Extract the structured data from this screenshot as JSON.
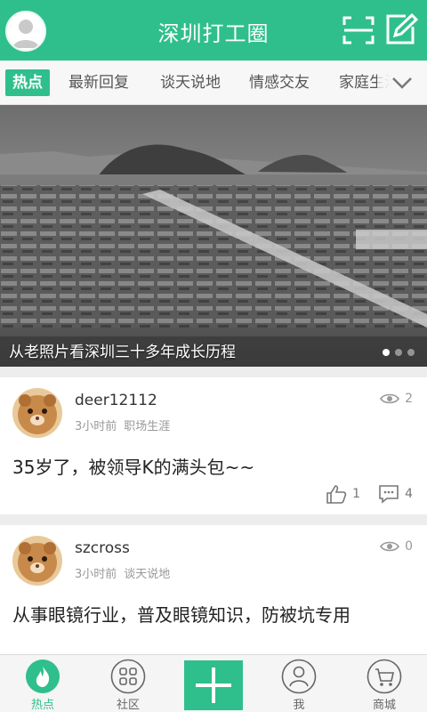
{
  "header": {
    "title": "深圳打工圈",
    "avatar_icon": "default-user-avatar",
    "scan_icon": "scan-icon",
    "edit_icon": "edit-icon",
    "brand_color": "#2fbf8c"
  },
  "tabs": {
    "items": [
      {
        "label": "热点",
        "active": true
      },
      {
        "label": "最新回复",
        "active": false
      },
      {
        "label": "谈天说地",
        "active": false
      },
      {
        "label": "情感交友",
        "active": false
      },
      {
        "label": "家庭生活",
        "active": false
      }
    ],
    "more_icon": "chevron-down-icon"
  },
  "banner": {
    "caption": "从老照片看深圳三十多年成长历程",
    "slide_count": 3,
    "current_slide": 1
  },
  "posts": [
    {
      "user": "deer12112",
      "time": "3小时前",
      "category": "职场生涯",
      "views": "2",
      "body": "35岁了，被领导K的满头包~~",
      "likes": "1",
      "comments": "4"
    },
    {
      "user": "szcross",
      "time": "3小时前",
      "category": "谈天说地",
      "views": "0",
      "body": "从事眼镜行业，普及眼镜知识，防被坑专用"
    }
  ],
  "bottom_nav": {
    "items": [
      {
        "label": "热点",
        "icon": "flame-icon",
        "active": true
      },
      {
        "label": "社区",
        "icon": "grid-icon",
        "active": false
      },
      {
        "label": "",
        "icon": "plus-icon",
        "active": false
      },
      {
        "label": "我",
        "icon": "user-icon",
        "active": false
      },
      {
        "label": "商城",
        "icon": "cart-icon",
        "active": false
      }
    ]
  }
}
